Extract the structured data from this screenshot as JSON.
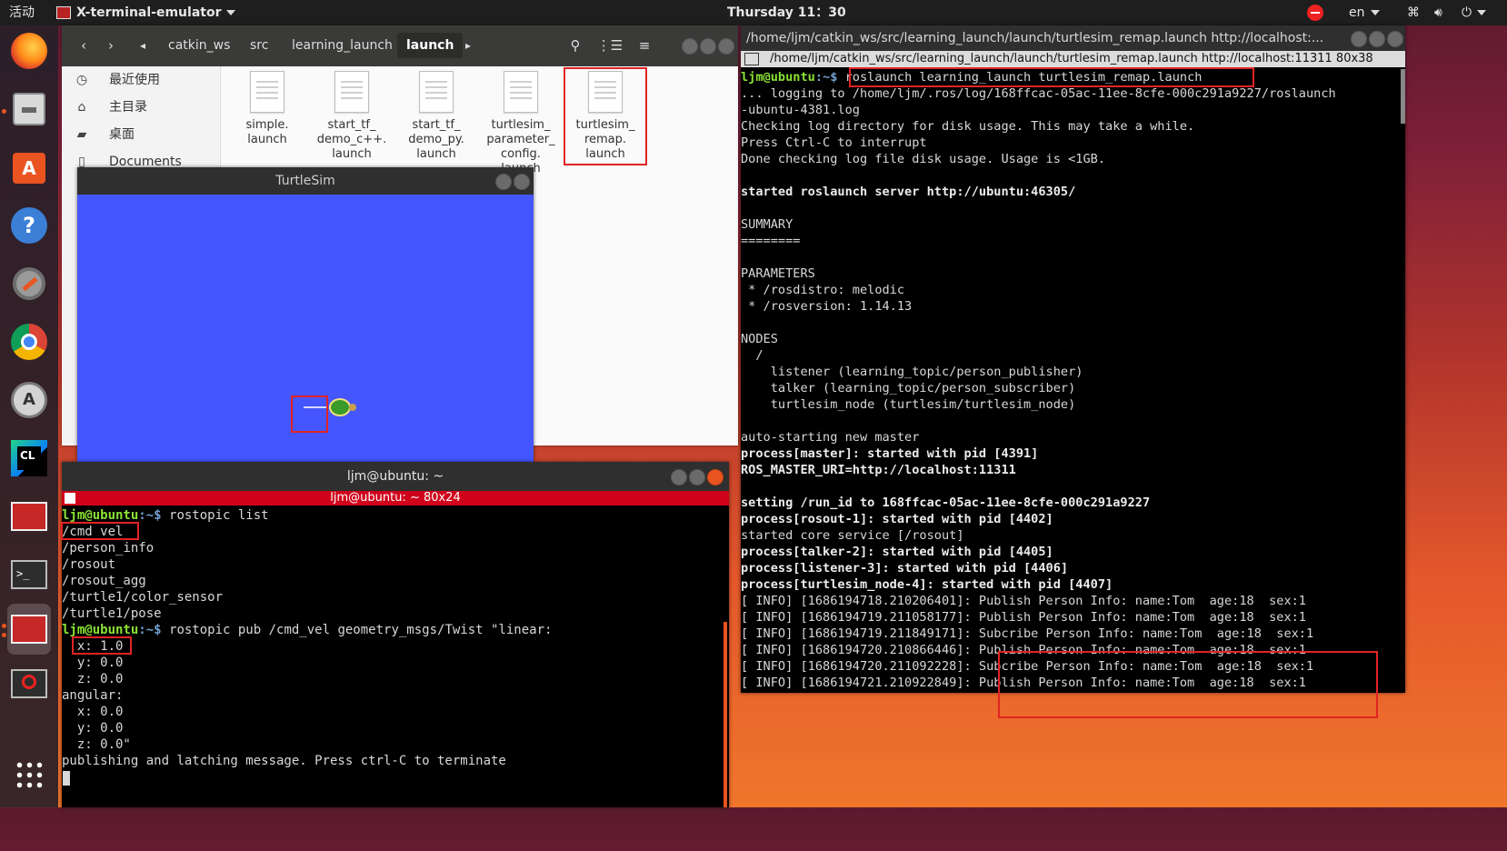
{
  "topbar": {
    "activities": "活动",
    "app_name": "X-terminal-emulator",
    "clock": "Thursday 11：30",
    "lang": "en"
  },
  "dock": {
    "apps": [
      "firefox",
      "files",
      "software-store",
      "help",
      "settings",
      "chrome",
      "software-updater",
      "clion",
      "x-terminal",
      "terminal",
      "x-terminal-active",
      "blocked-app",
      "show-apps"
    ]
  },
  "files": {
    "breadcrumbs": [
      "catkin_ws",
      "src",
      "learning_launch",
      "launch"
    ],
    "sidebar": [
      {
        "icon": "clock-icon",
        "label": "最近使用"
      },
      {
        "icon": "home-icon",
        "label": "主目录"
      },
      {
        "icon": "folder-icon",
        "label": "桌面"
      },
      {
        "icon": "document-icon",
        "label": "Documents"
      }
    ],
    "items": [
      {
        "lines": [
          "simple.",
          "launch"
        ]
      },
      {
        "lines": [
          "start_tf_",
          "demo_c++.",
          "launch"
        ]
      },
      {
        "lines": [
          "start_tf_",
          "demo_py.",
          "launch"
        ]
      },
      {
        "lines": [
          "turtlesim_",
          "parameter_",
          "config.",
          "launch"
        ]
      },
      {
        "lines": [
          "turtlesim_",
          "remap.",
          "launch"
        ]
      }
    ]
  },
  "turtlesim": {
    "title": "TurtleSim",
    "bg_color": "#4556ff"
  },
  "term1": {
    "title": "ljm@ubuntu: ~",
    "subtitle": "ljm@ubuntu: ~ 80x24",
    "prompt_user": "ljm@ubuntu",
    "prompt_path": ":~$ ",
    "cmd1": "rostopic list",
    "topics": [
      "/cmd_vel",
      "/person_info",
      "/rosout",
      "/rosout_agg",
      "/turtle1/color_sensor",
      "/turtle1/pose"
    ],
    "cmd2": "rostopic pub /cmd_vel geometry_msgs/Twist \"linear:",
    "body": [
      "  x: 1.0",
      "  y: 0.0",
      "  z: 0.0",
      "angular:",
      "  x: 0.0",
      "  y: 0.0",
      "  z: 0.0\"",
      "publishing and latching message. Press ctrl-C to terminate"
    ]
  },
  "term2": {
    "title": "/home/ljm/catkin_ws/src/learning_launch/launch/turtlesim_remap.launch http://localhost:...",
    "subtitle": "/home/ljm/catkin_ws/src/learning_launch/launch/turtlesim_remap.launch http://localhost:11311 80x38",
    "prompt_user": "ljm@ubuntu",
    "prompt_path": ":~$ ",
    "cmd": "roslaunch learning_launch turtlesim_remap.launch",
    "lines": [
      {
        "t": "... logging to /home/ljm/.ros/log/168ffcac-05ac-11ee-8cfe-000c291a9227/roslaunch",
        "b": false
      },
      {
        "t": "-ubuntu-4381.log",
        "b": false
      },
      {
        "t": "Checking log directory for disk usage. This may take a while.",
        "b": false
      },
      {
        "t": "Press Ctrl-C to interrupt",
        "b": false
      },
      {
        "t": "Done checking log file disk usage. Usage is <1GB.",
        "b": false
      },
      {
        "t": "",
        "b": false
      },
      {
        "t": "started roslaunch server http://ubuntu:46305/",
        "b": true
      },
      {
        "t": "",
        "b": false
      },
      {
        "t": "SUMMARY",
        "b": false
      },
      {
        "t": "========",
        "b": false
      },
      {
        "t": "",
        "b": false
      },
      {
        "t": "PARAMETERS",
        "b": false
      },
      {
        "t": " * /rosdistro: melodic",
        "b": false
      },
      {
        "t": " * /rosversion: 1.14.13",
        "b": false
      },
      {
        "t": "",
        "b": false
      },
      {
        "t": "NODES",
        "b": false
      },
      {
        "t": "  /",
        "b": false
      },
      {
        "t": "    listener (learning_topic/person_publisher)",
        "b": false
      },
      {
        "t": "    talker (learning_topic/person_subscriber)",
        "b": false
      },
      {
        "t": "    turtlesim_node (turtlesim/turtlesim_node)",
        "b": false
      },
      {
        "t": "",
        "b": false
      },
      {
        "t": "auto-starting new master",
        "b": false
      },
      {
        "t": "process[master]: started with pid [4391]",
        "b": true
      },
      {
        "t": "ROS_MASTER_URI=http://localhost:11311",
        "b": true
      },
      {
        "t": "",
        "b": false
      },
      {
        "t": "setting /run_id to 168ffcac-05ac-11ee-8cfe-000c291a9227",
        "b": true
      },
      {
        "t": "process[rosout-1]: started with pid [4402]",
        "b": true
      },
      {
        "t": "started core service [/rosout]",
        "b": false
      },
      {
        "t": "process[talker-2]: started with pid [4405]",
        "b": true
      },
      {
        "t": "process[listener-3]: started with pid [4406]",
        "b": true
      },
      {
        "t": "process[turtlesim_node-4]: started with pid [4407]",
        "b": true
      },
      {
        "t": "[ INFO] [1686194718.210206401]: Publish Person Info: name:Tom  age:18  sex:1",
        "b": false
      },
      {
        "t": "[ INFO] [1686194719.211058177]: Publish Person Info: name:Tom  age:18  sex:1",
        "b": false
      },
      {
        "t": "[ INFO] [1686194719.211849171]: Subcribe Person Info: name:Tom  age:18  sex:1",
        "b": false
      },
      {
        "t": "[ INFO] [1686194720.210866446]: Publish Person Info: name:Tom  age:18  sex:1",
        "b": false
      },
      {
        "t": "[ INFO] [1686194720.211092228]: Subcribe Person Info: name:Tom  age:18  sex:1",
        "b": false
      },
      {
        "t": "[ INFO] [1686194721.210922849]: Publish Person Info: name:Tom  age:18  sex:1",
        "b": false
      }
    ]
  }
}
